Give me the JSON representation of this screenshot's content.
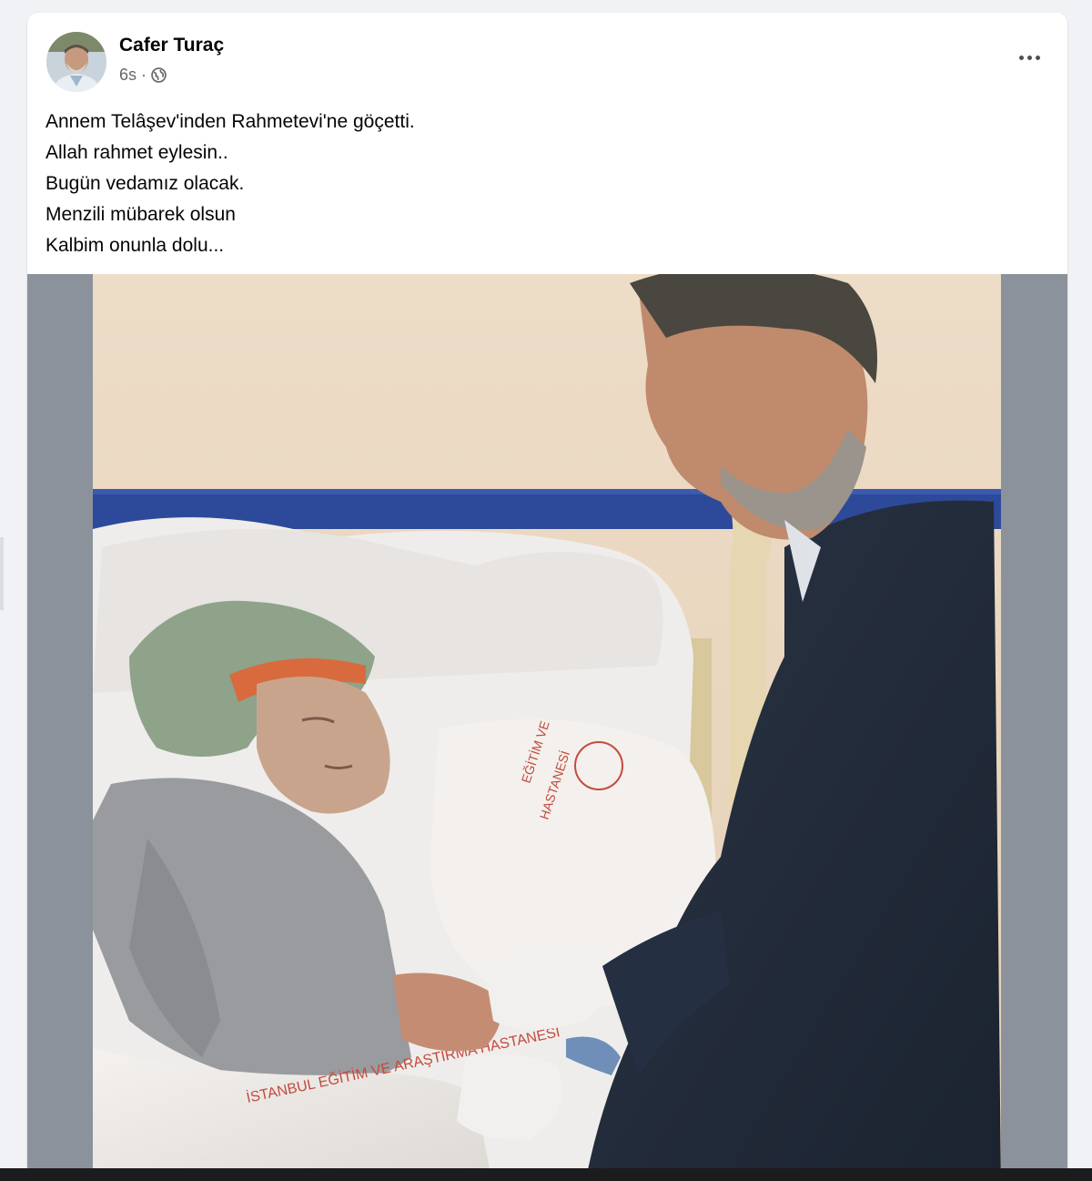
{
  "post": {
    "author": {
      "name": "Cafer Turaç",
      "avatar_icon": "profile-photo"
    },
    "meta": {
      "time": "6s",
      "separator": "·",
      "privacy_icon": "globe-icon"
    },
    "more_icon": "more-horizontal-icon",
    "text_lines": [
      "Annem Telâşev'inden Rahmetevi'ne göçetti.",
      "Allah rahmet eylesin..",
      "Bugün vedamız olacak.",
      "Menzili mübarek olsun",
      "Kalbim onunla dolu..."
    ],
    "photo": {
      "description_icon": "post-photo",
      "pillow_text_1": "EĞİTİM VE\nARAŞTIRMA HASTANESİ",
      "blanket_text": "İSTANBUL EĞİTİM VE ARAŞTIRMA HASTANESİ"
    }
  },
  "colors": {
    "page_bg": "#f0f2f5",
    "card_bg": "#ffffff",
    "text_primary": "#050505",
    "text_secondary": "#65676b",
    "photo_letterbox": "#8c929b"
  }
}
